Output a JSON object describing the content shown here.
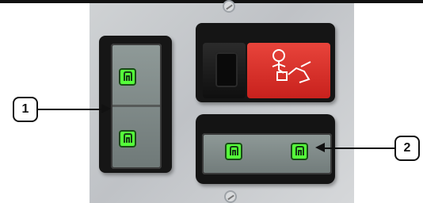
{
  "callouts": [
    {
      "label": "1"
    },
    {
      "label": "2"
    }
  ],
  "icons": {
    "left_top": "green-symbol-icon",
    "left_bottom": "green-symbol-icon",
    "right_left": "green-symbol-icon",
    "right_right": "green-symbol-icon",
    "red": "safety-symbol-icon",
    "screws": "screw-icon"
  },
  "colors": {
    "panel": "#c6c9cc",
    "switch_black": "#151515",
    "switch_face": "#7f8988",
    "indicator_green": "#55ff3a",
    "red_face": "#d73129",
    "callout_border": "#111111"
  }
}
